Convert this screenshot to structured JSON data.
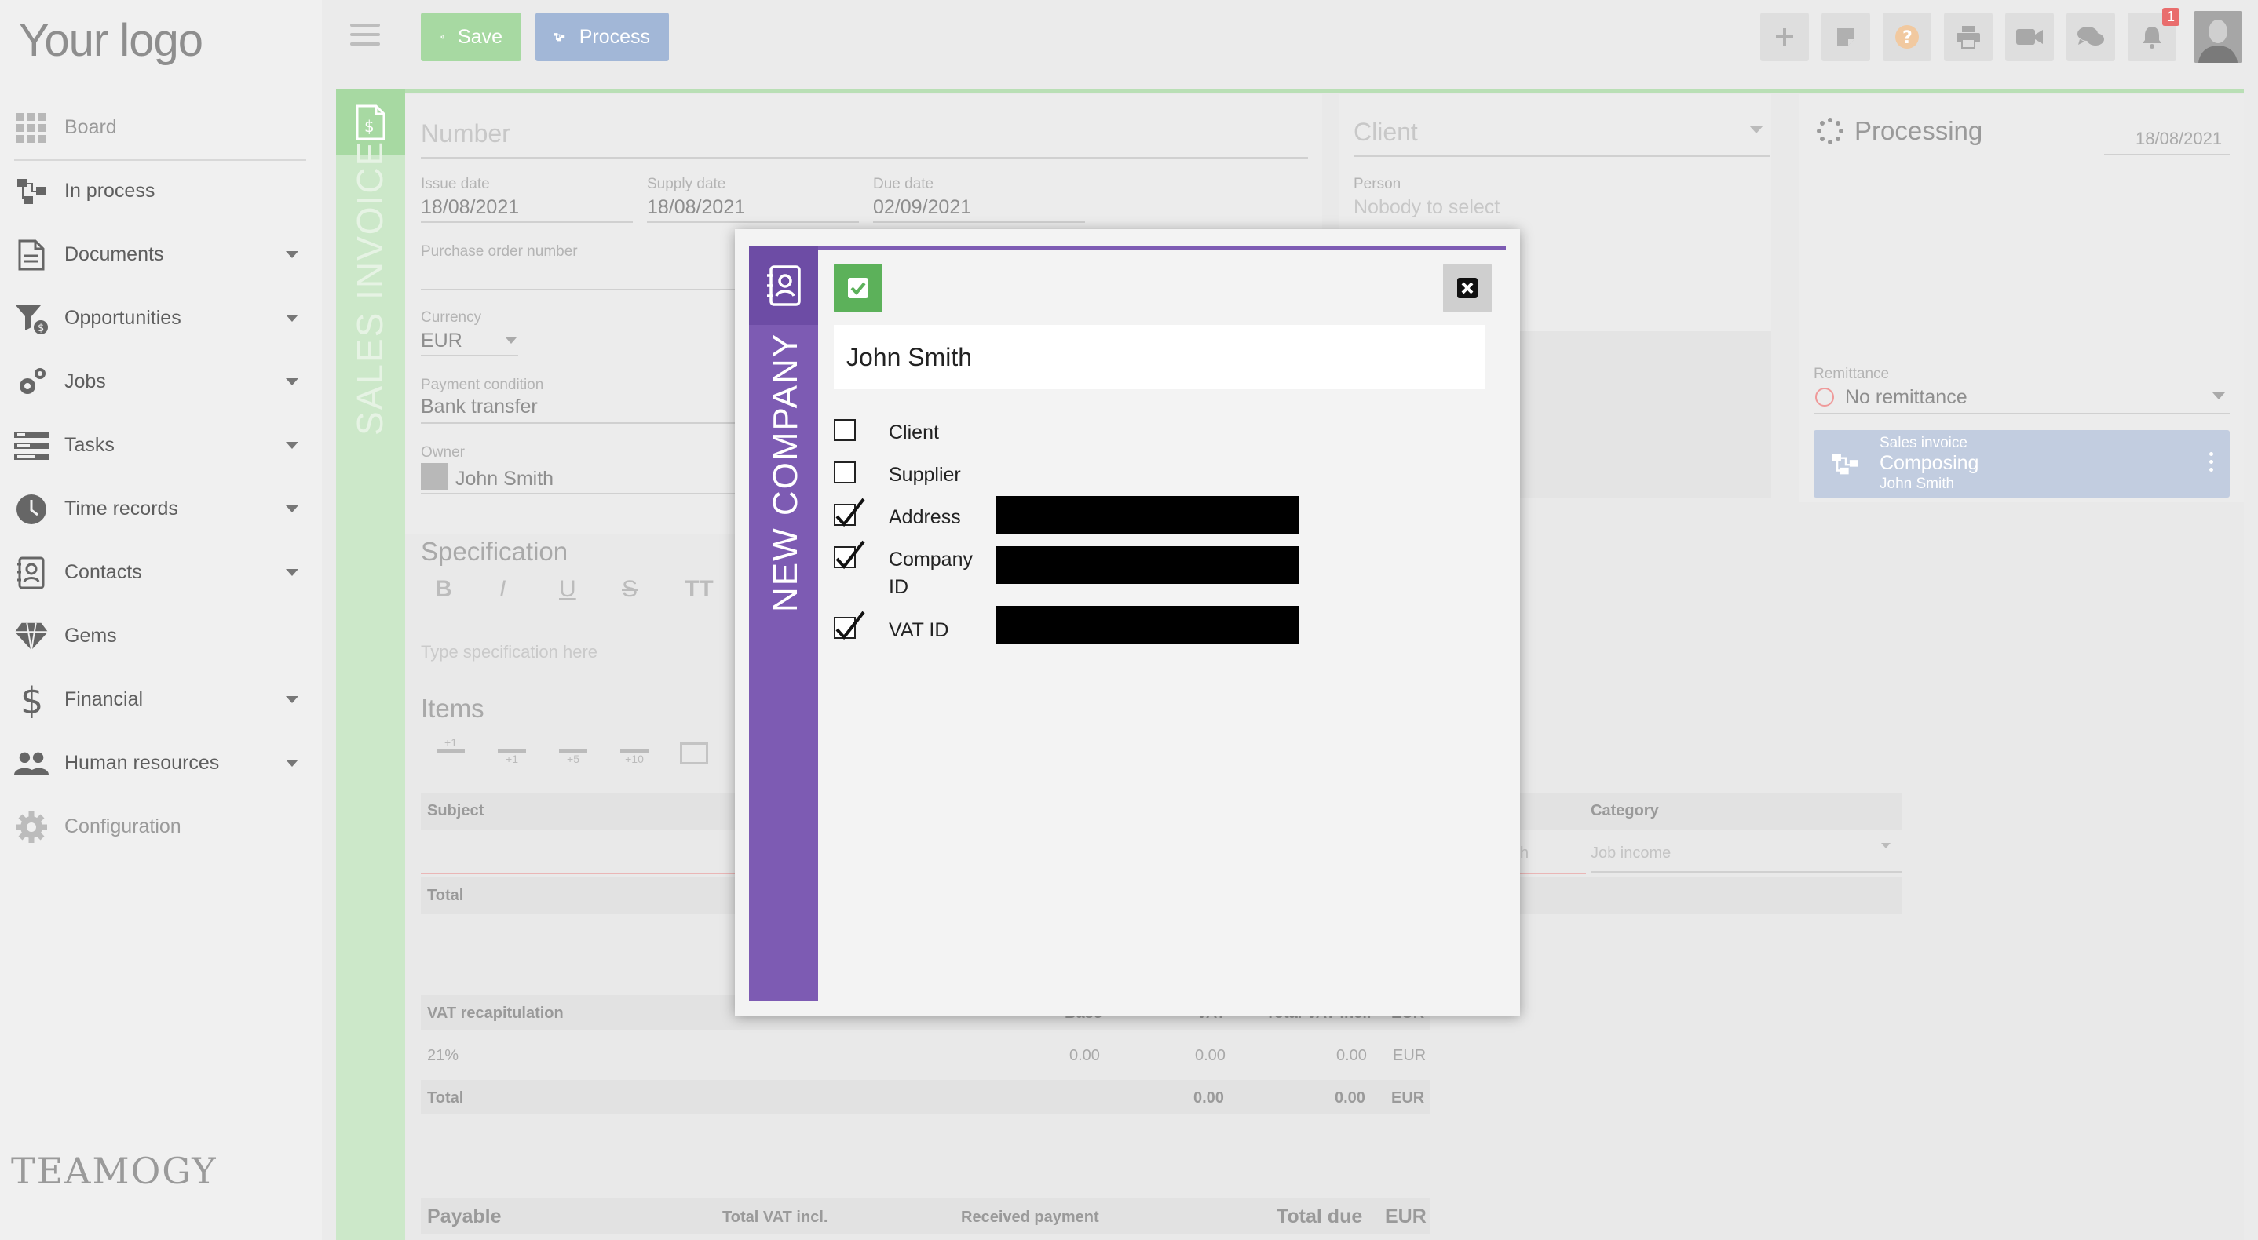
{
  "app": {
    "logo": "Your logo",
    "brand": "TEAMOGY"
  },
  "sidebar": {
    "items": [
      {
        "label": "Board",
        "icon": "grid-icon",
        "caret": false,
        "muted": true
      },
      {
        "label": "In process",
        "icon": "workflow-icon",
        "caret": false,
        "muted": false
      },
      {
        "label": "Documents",
        "icon": "document-icon",
        "caret": true,
        "muted": false
      },
      {
        "label": "Opportunities",
        "icon": "funnel-icon",
        "caret": true,
        "muted": false
      },
      {
        "label": "Jobs",
        "icon": "gears-icon",
        "caret": true,
        "muted": false
      },
      {
        "label": "Tasks",
        "icon": "tasks-icon",
        "caret": true,
        "muted": false
      },
      {
        "label": "Time records",
        "icon": "clock-icon",
        "caret": true,
        "muted": false
      },
      {
        "label": "Contacts",
        "icon": "contacts-icon",
        "caret": true,
        "muted": false
      },
      {
        "label": "Gems",
        "icon": "diamond-icon",
        "caret": false,
        "muted": false
      },
      {
        "label": "Financial",
        "icon": "dollar-icon",
        "caret": true,
        "muted": false
      },
      {
        "label": "Human resources",
        "icon": "people-icon",
        "caret": true,
        "muted": false
      },
      {
        "label": "Configuration",
        "icon": "gear-icon",
        "caret": false,
        "muted": true
      }
    ]
  },
  "toolbar": {
    "save_label": "Save",
    "process_label": "Process",
    "notifications_count": "1"
  },
  "document": {
    "type_label": "SALES INVOICE",
    "number_placeholder": "Number",
    "issue_date_label": "Issue date",
    "issue_date": "18/08/2021",
    "supply_date_label": "Supply date",
    "supply_date": "18/08/2021",
    "due_date_label": "Due date",
    "due_date": "02/09/2021",
    "po_label": "Purchase order number",
    "currency_label": "Currency",
    "currency": "EUR",
    "payment_condition_label": "Payment condition",
    "payment_condition": "Bank transfer",
    "owner_label": "Owner",
    "owner": "John Smith",
    "client_placeholder": "Client",
    "person_label": "Person",
    "person_placeholder": "Nobody to select",
    "specification_title": "Specification",
    "specification_placeholder": "Type specification here",
    "items_title": "Items",
    "items_buttons": [
      "+1",
      "+1",
      "+5",
      "+10"
    ],
    "subject_header": "Subject",
    "category_header": "Category",
    "category_value": "Job income",
    "search_fragment": "ch",
    "total_label": "Total",
    "vat_recap_label": "VAT recapitulation",
    "vat_cols": [
      "Base",
      "VAT",
      "Total VAT incl.",
      "EUR"
    ],
    "vat_rows": [
      {
        "rate": "21%",
        "base": "0.00",
        "vat": "0.00",
        "total": "0.00",
        "cur": "EUR"
      }
    ],
    "vat_total": {
      "label": "Total",
      "vat": "0.00",
      "total": "0.00",
      "cur": "EUR"
    },
    "payable_label": "Payable",
    "payable_cols": [
      "Total VAT incl.",
      "Received payment",
      "Total due",
      "EUR"
    ],
    "formatting": [
      "B",
      "I",
      "U",
      "S",
      "TT"
    ]
  },
  "processing": {
    "title": "Processing",
    "date": "18/08/2021",
    "remittance_label": "Remittance",
    "remittance_value": "No remittance",
    "workflow": {
      "type": "Sales invoice",
      "state": "Composing",
      "user": "John Smith"
    }
  },
  "modal": {
    "title": "NEW COMPANY",
    "name_value": "John Smith",
    "options": [
      {
        "label": "Client",
        "checked": false,
        "redacted": false
      },
      {
        "label": "Supplier",
        "checked": false,
        "redacted": false
      },
      {
        "label": "Address",
        "checked": true,
        "redacted": true
      },
      {
        "label": "Company ID",
        "checked": true,
        "redacted": true
      },
      {
        "label": "VAT ID",
        "checked": true,
        "redacted": true
      }
    ]
  }
}
